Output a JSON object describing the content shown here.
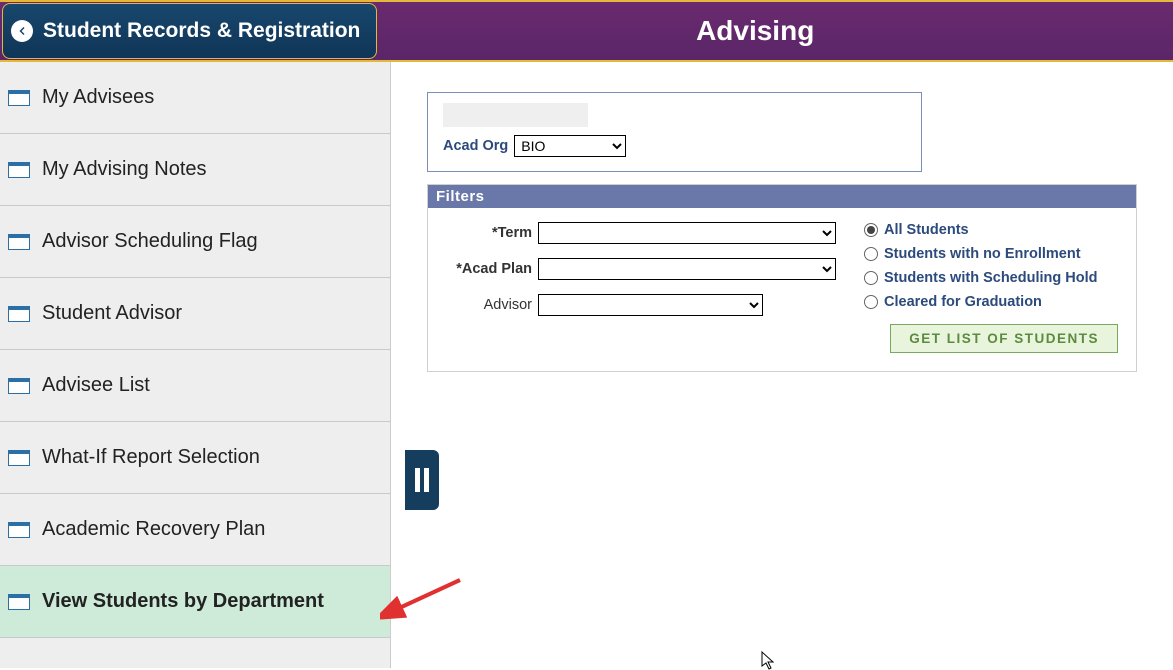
{
  "header": {
    "back_title": "Student Records & Registration",
    "page_title": "Advising"
  },
  "sidebar": {
    "items": [
      {
        "label": "My Advisees"
      },
      {
        "label": "My Advising Notes"
      },
      {
        "label": "Advisor Scheduling Flag"
      },
      {
        "label": "Student Advisor"
      },
      {
        "label": "Advisee List"
      },
      {
        "label": "What-If Report Selection"
      },
      {
        "label": "Academic Recovery Plan"
      },
      {
        "label": "View Students by Department"
      }
    ],
    "active_index": 7
  },
  "top_panel": {
    "acad_org_label": "Acad Org",
    "acad_org_value": "BIO"
  },
  "filters": {
    "header": "Filters",
    "term_label": "*Term",
    "acad_plan_label": "*Acad Plan",
    "advisor_label": "Advisor",
    "term_value": "",
    "acad_plan_value": "",
    "advisor_value": "",
    "radios": [
      {
        "label": "All Students",
        "checked": true
      },
      {
        "label": "Students with no Enrollment",
        "checked": false
      },
      {
        "label": "Students with Scheduling Hold",
        "checked": false
      },
      {
        "label": "Cleared for Graduation",
        "checked": false
      }
    ],
    "button_label": "GET LIST OF STUDENTS"
  }
}
